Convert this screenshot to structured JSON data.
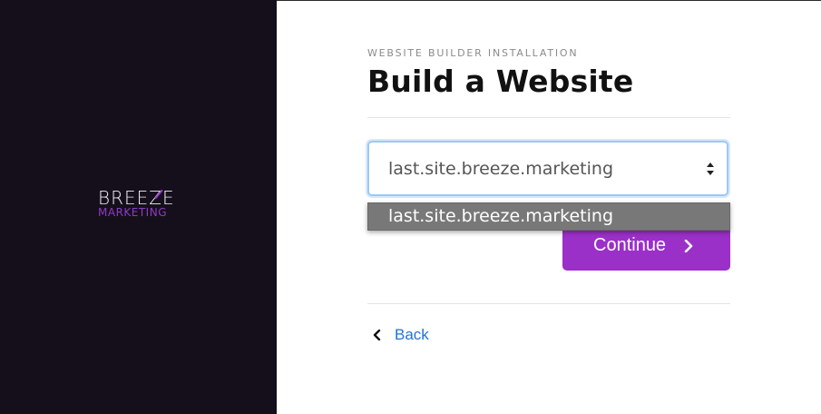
{
  "brand": {
    "logo_top": "BREEZE",
    "logo_bottom": "MARKETING",
    "accent_color": "#9b30c9",
    "panel_color": "#150f1c"
  },
  "header": {
    "eyebrow": "WEBSITE BUILDER INSTALLATION",
    "title": "Build a Website"
  },
  "site_select": {
    "value": "last.site.breeze.marketing",
    "options": [
      "last.site.breeze.marketing"
    ],
    "highlighted_option": "last.site.breeze.marketing",
    "icon": "select-arrows-icon"
  },
  "actions": {
    "continue_label": "Continue",
    "continue_icon": "chevron-right-icon",
    "back_label": "Back",
    "back_icon": "chevron-left-icon"
  },
  "colors": {
    "link": "#1e73d6",
    "focus_ring": "#9fc8f1",
    "dropdown_bg": "#787878"
  }
}
